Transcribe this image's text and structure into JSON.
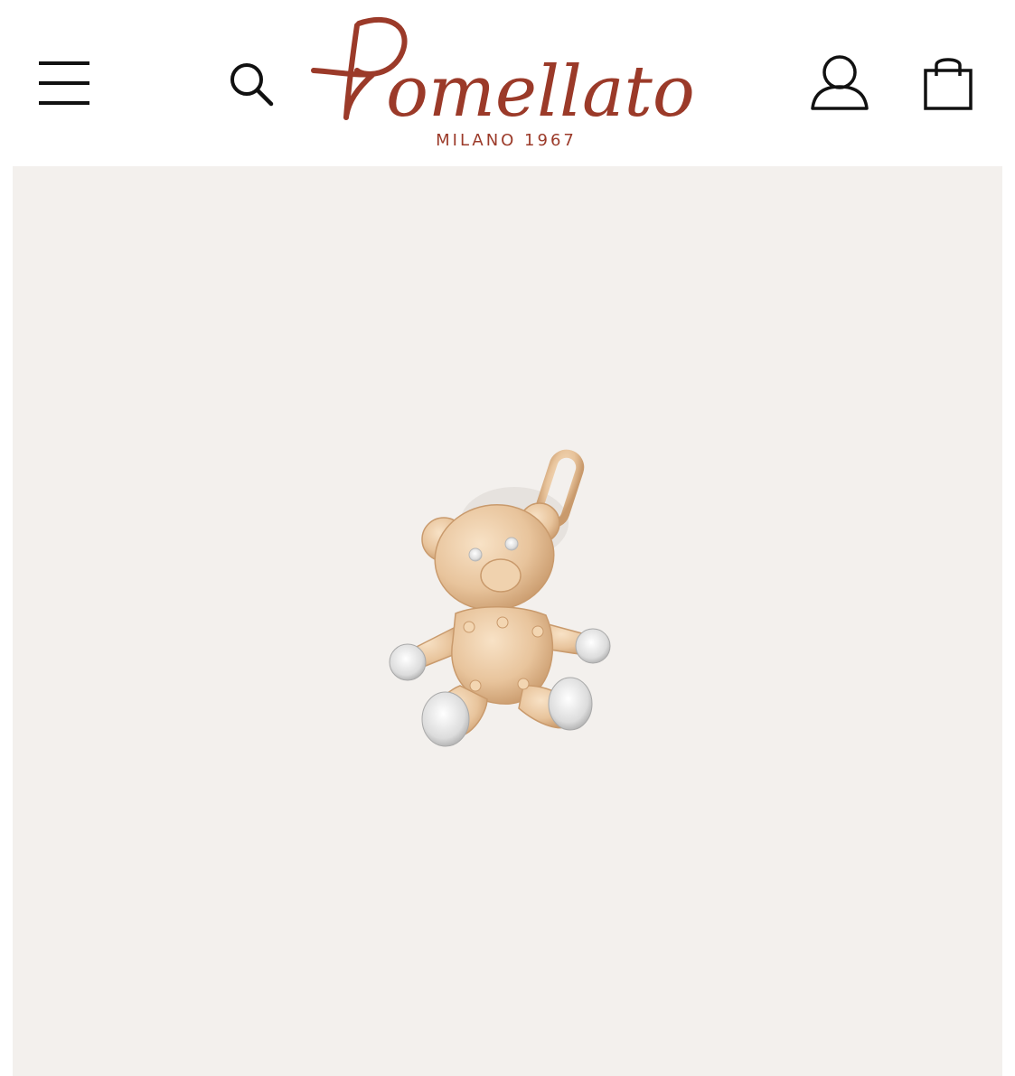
{
  "header": {
    "menu_icon": "hamburger-menu-icon",
    "search_icon": "search-icon",
    "account_icon": "user-account-icon",
    "bag_icon": "shopping-bag-icon",
    "logo": {
      "wordmark": "Pomellato",
      "tagline": "MILANO 1967"
    }
  },
  "product": {
    "image_subject": "teddy-bear-pendant"
  },
  "colors": {
    "brand": "#9b3a29",
    "panel_background": "#f3f0ed",
    "icon": "#111111",
    "gold": "#e8c8a4"
  }
}
